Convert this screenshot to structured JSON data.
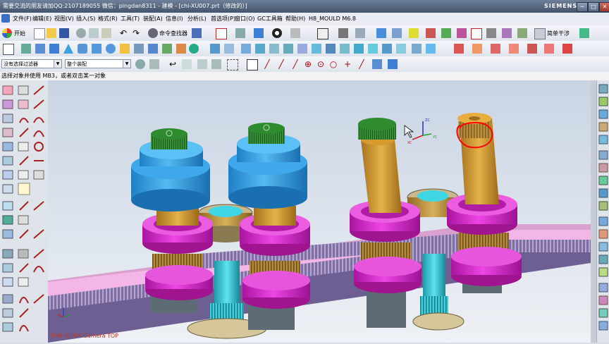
{
  "titlebar": {
    "text": "需要交流的朋友请加QQ:2107189055 微信：pingdan8311 - 建模 - [chi-XU007.prt（修改的）]",
    "brand": "SIEMENS",
    "min_label": "─",
    "max_label": "□",
    "close_label": "✕"
  },
  "menu": {
    "items": [
      "文件(F)",
      "编辑(E)",
      "视图(V)",
      "插入(S)",
      "格式(R)",
      "工具(T)",
      "装配(A)",
      "信息(I)",
      "分析(L)",
      "首选项(P)",
      "窗口(O)",
      "GC工具箱",
      "帮助(H)",
      "H8_MOULD M6.8"
    ]
  },
  "toolbar": {
    "start_label": "开始",
    "command_finder_label": "命令查找器",
    "simple_interference_label": "简单干涉"
  },
  "selection": {
    "filter_value": "没有选择过滤器",
    "scope_value": "整个装配"
  },
  "cue_line": {
    "text": "选择对象并使用 MB3，或者双击某一对象"
  },
  "viewport": {
    "view_label": "TOP WORK Camera TOP",
    "axis_labels": {
      "z": "ZC",
      "x": "XC",
      "y": "YC"
    },
    "colors": {
      "background_top": "#c9d4e3",
      "background_bottom": "#eef1f5",
      "rack": "#f4b6e6",
      "teeth": "#8c7fb0",
      "blue_housing": "#2b9be0",
      "green_cap": "#2e8b2e",
      "magenta_bearing": "#d21fc8",
      "tan_shaft": "#d69a2e",
      "brass_gear": "#c39740",
      "cyan_gear": "#33c8d8",
      "highlight": "#ff0000"
    }
  }
}
